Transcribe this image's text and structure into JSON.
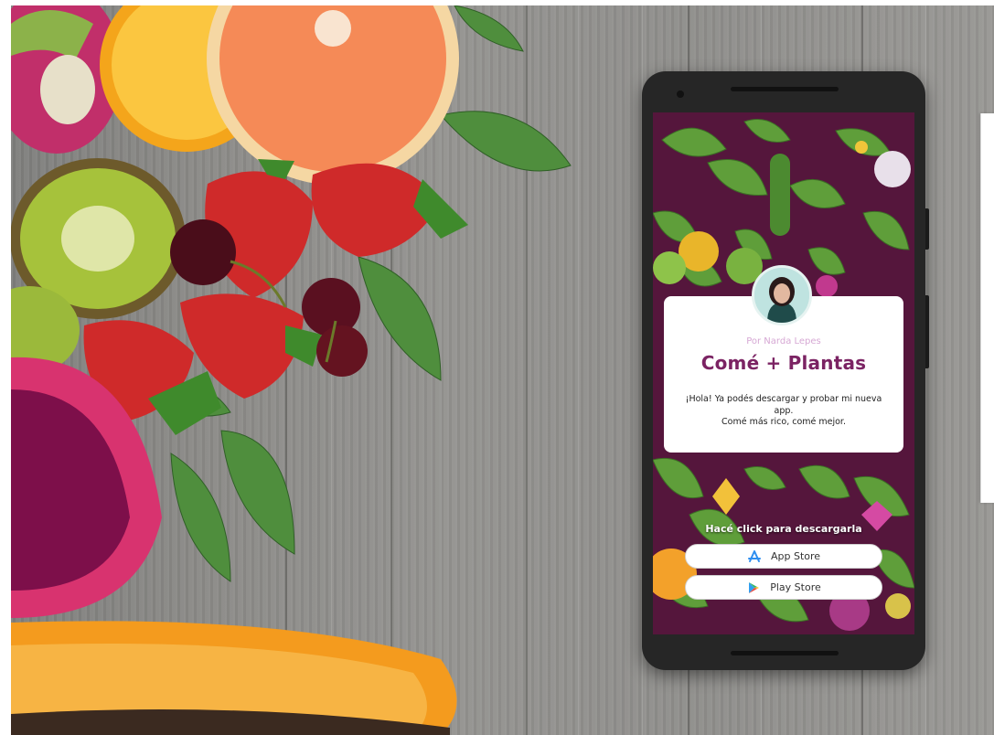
{
  "promo": {
    "byline": "Por Narda Lepes",
    "app_title": "Comé + Plantas",
    "message_line1": "¡Hola! Ya podés descargar y probar mi nueva app.",
    "message_line2": "Comé más rico, comé mejor.",
    "cta": "Hacé click para descargarla",
    "app_store_label": "App Store",
    "play_store_label": "Play Store"
  },
  "icons": {
    "app_store": "app-store-icon",
    "play_store": "play-store-icon"
  },
  "colors": {
    "screen_background": "#55163c",
    "title": "#7b2363",
    "byline": "#d6a8d4",
    "wood": "#8e8d8a"
  }
}
